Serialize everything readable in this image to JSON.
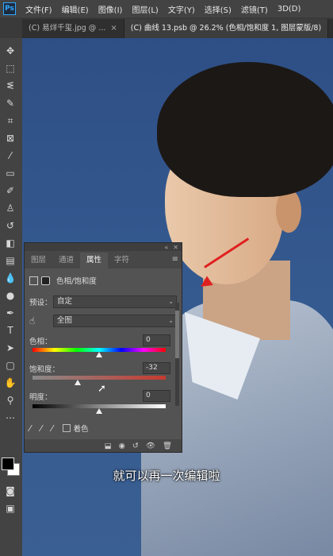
{
  "menubar": {
    "logo": "Ps",
    "items": [
      "文件(F)",
      "编辑(E)",
      "图像(I)",
      "图层(L)",
      "文字(Y)",
      "选择(S)",
      "滤镜(T)",
      "3D(D)"
    ]
  },
  "tabs": [
    {
      "label": "(C) 易烊千玺.jpg @ ...",
      "close": "×"
    },
    {
      "label": "(C) 曲线 13.psb @ 26.2% (色相/饱和度 1, 图层蒙版/8)",
      "close": "×"
    }
  ],
  "panel": {
    "tabs": [
      "图层",
      "通道",
      "属性",
      "字符"
    ],
    "active_tab": "属性",
    "title": "色相/饱和度",
    "preset_label": "预设：",
    "preset_value": "自定",
    "range_value": "全图",
    "hue_label": "色相：",
    "hue_value": "0",
    "hue_position": 0.5,
    "saturation_label": "饱和度：",
    "saturation_value": "-32",
    "saturation_position": 0.34,
    "lightness_label": "明度：",
    "lightness_value": "0",
    "lightness_position": 0.5,
    "colorize_label": "着色"
  },
  "subtitle": "就可以再一次编辑啦",
  "colors": {
    "arrow": "#e02020",
    "canvas_bg": "#2e4f86"
  }
}
